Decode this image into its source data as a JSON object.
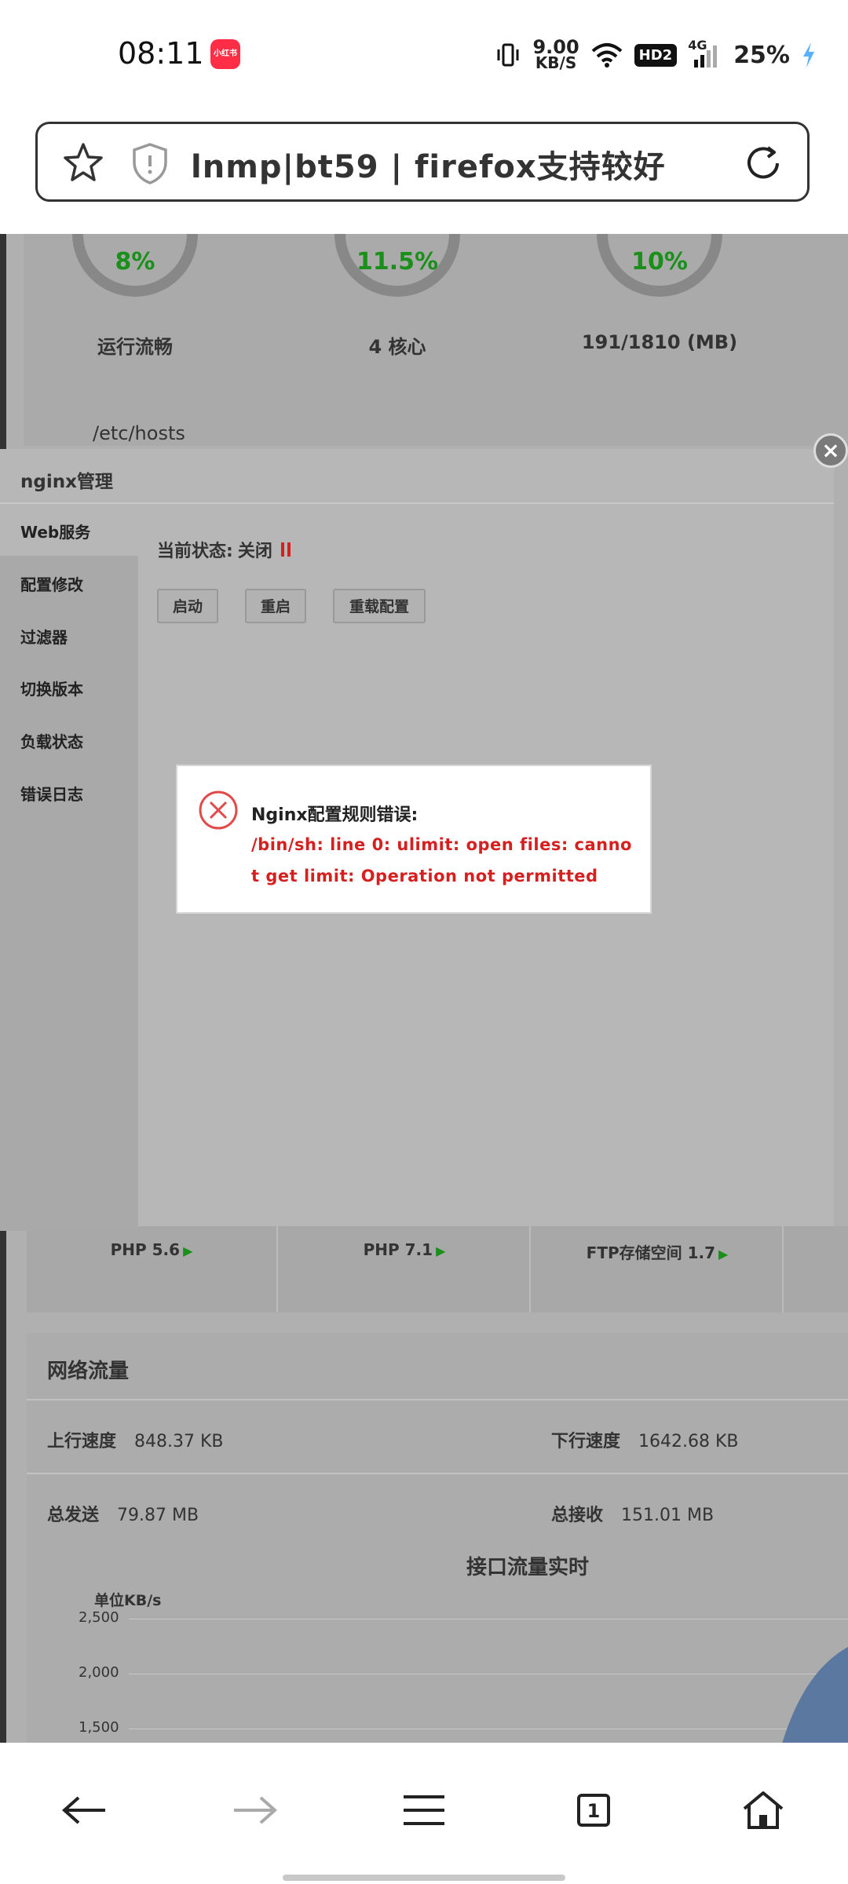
{
  "status_bar": {
    "time": "08:11",
    "app_badge": "小红书",
    "net_speed_value": "9.00",
    "net_speed_unit": "KB/S",
    "hd_label": "HD2",
    "signal_label": "4G",
    "battery": "25%"
  },
  "url_bar": {
    "title": "lnmp|bt59 | firefox支持较好"
  },
  "stats": {
    "gauges": [
      {
        "value": "8%",
        "label": "运行流畅"
      },
      {
        "value": "11.5%",
        "label": "4 核心"
      },
      {
        "value": "10%",
        "label": "191/1810 (MB)"
      }
    ],
    "hosts_path": "/etc/hosts"
  },
  "nginx_modal": {
    "title": "nginx管理",
    "sidebar": [
      "Web服务",
      "配置修改",
      "过滤器",
      "切换版本",
      "负载状态",
      "错误日志"
    ],
    "status_label": "当前状态:",
    "status_value": "关闭",
    "buttons": [
      "启动",
      "重启",
      "重载配置"
    ],
    "close_symbol": "×"
  },
  "error_dialog": {
    "title": "Nginx配置规则错误:",
    "message": "/bin/sh: line 0: ulimit: open files: cannot get limit: Operation not permitted"
  },
  "php_row": [
    {
      "label": "PHP 5.6"
    },
    {
      "label": "PHP 7.1"
    },
    {
      "label": "FTP存储空间 1.7"
    }
  ],
  "network": {
    "heading": "网络流量",
    "upload_label": "上行速度",
    "upload_value": "848.37 KB",
    "download_label": "下行速度",
    "download_value": "1642.68 KB",
    "sent_label": "总发送",
    "sent_value": "79.87 MB",
    "received_label": "总接收",
    "received_value": "151.01 MB",
    "chart_title": "接口流量实时",
    "unit_label": "单位KB/s",
    "ticks": [
      "2,500",
      "2,000",
      "1,500"
    ]
  },
  "bottom_nav": {
    "tab_count": "1"
  },
  "colors": {
    "error_red": "#d62020",
    "ok_green": "#1a8f1a",
    "overlay_gray": "#b0b0b0"
  }
}
